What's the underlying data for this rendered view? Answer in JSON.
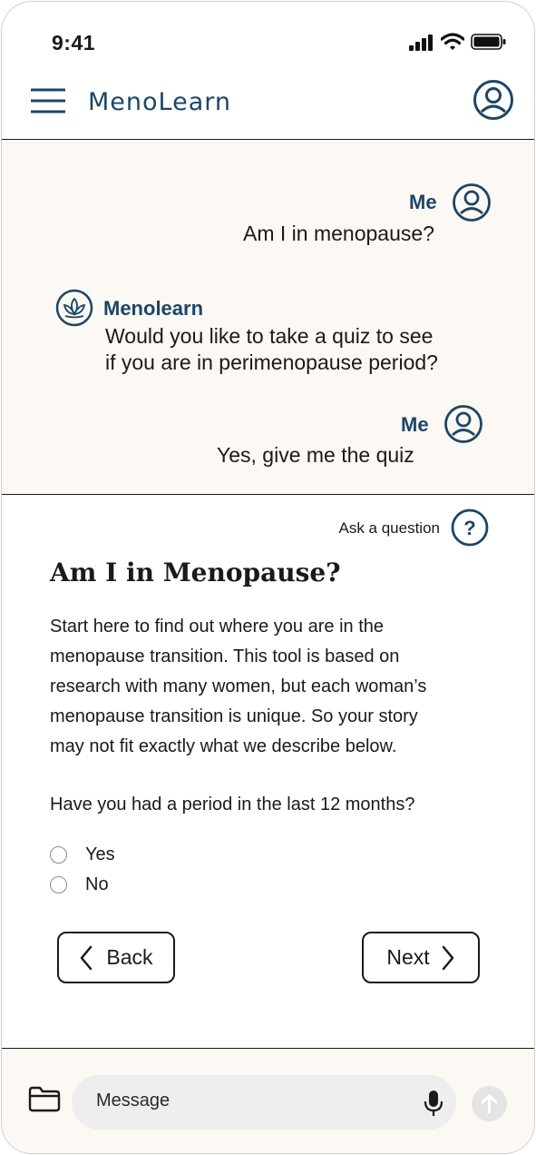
{
  "status": {
    "time": "9:41"
  },
  "app": {
    "title": "MenoLearn"
  },
  "chat": {
    "messages": [
      {
        "sender": "Me",
        "text": "Am I in menopause?"
      },
      {
        "sender": "Menolearn",
        "text_line1": "Would you like to take a quiz to see",
        "text_line2": "if you are in perimenopause period?"
      },
      {
        "sender": "Me",
        "text": "Yes, give me the quiz"
      }
    ]
  },
  "quiz": {
    "ask_label": "Ask a question",
    "title": "Am I in Menopause?",
    "description_lines": [
      "Start here to find out where you are in the",
      "menopause transition. This tool is based on",
      "research with many women, but each woman’s",
      "menopause transition is unique. So your story",
      "may not fit exactly what we describe below."
    ],
    "question": "Have you had a period in the last 12 months?",
    "options": [
      "Yes",
      "No"
    ],
    "back_label": "Back",
    "next_label": "Next"
  },
  "composer": {
    "placeholder": "Message"
  },
  "colors": {
    "brand": "#1d4566",
    "chat_bg": "#fcf8f4",
    "divider": "#1b1b1b"
  },
  "icons": [
    "menu-icon",
    "profile-icon",
    "user-avatar-icon",
    "lotus-icon",
    "help-icon",
    "chevron-left-icon",
    "chevron-right-icon",
    "folder-icon",
    "microphone-icon",
    "send-arrow-icon",
    "signal-icon",
    "wifi-icon",
    "battery-icon"
  ]
}
